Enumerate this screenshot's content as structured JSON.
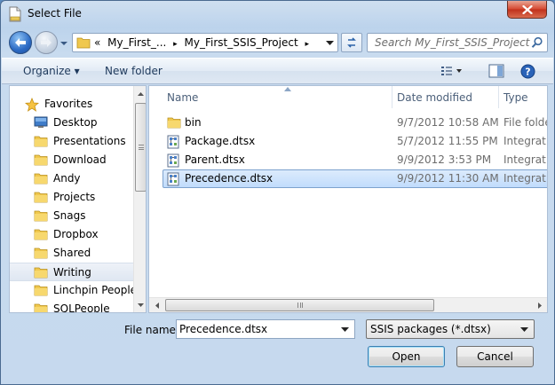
{
  "window": {
    "title": "Select File"
  },
  "nav": {
    "back_icon": "back-arrow-icon",
    "forward_icon": "forward-arrow-icon"
  },
  "address": {
    "overflow": "«",
    "crumbs": [
      "My_First_...",
      "My_First_SSIS_Project"
    ],
    "separator": "▸"
  },
  "search": {
    "placeholder": "Search My_First_SSIS_Project"
  },
  "toolbar": {
    "organize_label": "Organize ▾",
    "new_folder_label": "New folder"
  },
  "sidebar": {
    "items": [
      {
        "label": "Favorites",
        "icon": "star-icon",
        "type": "favorites"
      },
      {
        "label": "Desktop",
        "icon": "desktop-icon"
      },
      {
        "label": "Presentations",
        "icon": "folder-icon"
      },
      {
        "label": "Download",
        "icon": "folder-icon"
      },
      {
        "label": "Andy",
        "icon": "folder-icon"
      },
      {
        "label": "Projects",
        "icon": "folder-icon"
      },
      {
        "label": "Snags",
        "icon": "folder-icon"
      },
      {
        "label": "Dropbox",
        "icon": "folder-icon"
      },
      {
        "label": "Shared",
        "icon": "folder-icon"
      },
      {
        "label": "Writing",
        "icon": "folder-icon",
        "selected": true
      },
      {
        "label": "Linchpin People",
        "icon": "folder-icon"
      },
      {
        "label": "SQLPeople",
        "icon": "folder-icon"
      }
    ]
  },
  "files": {
    "columns": {
      "name": "Name",
      "date": "Date modified",
      "type": "Type"
    },
    "rows": [
      {
        "name": "bin",
        "date": "9/7/2012 10:58 AM",
        "type": "File folder",
        "icon": "folder-icon"
      },
      {
        "name": "Package.dtsx",
        "date": "5/7/2012 11:55 PM",
        "type": "Integration",
        "icon": "dtsx-file-icon"
      },
      {
        "name": "Parent.dtsx",
        "date": "9/9/2012 3:53 PM",
        "type": "Integration",
        "icon": "dtsx-file-icon"
      },
      {
        "name": "Precedence.dtsx",
        "date": "9/9/2012 11:30 AM",
        "type": "Integration",
        "icon": "dtsx-file-icon",
        "selected": true
      }
    ]
  },
  "footer": {
    "file_name_label": "File name:",
    "file_name_value": "Precedence.dtsx",
    "file_type_value": "SSIS packages (*.dtsx)",
    "open_label": "Open",
    "cancel_label": "Cancel"
  }
}
